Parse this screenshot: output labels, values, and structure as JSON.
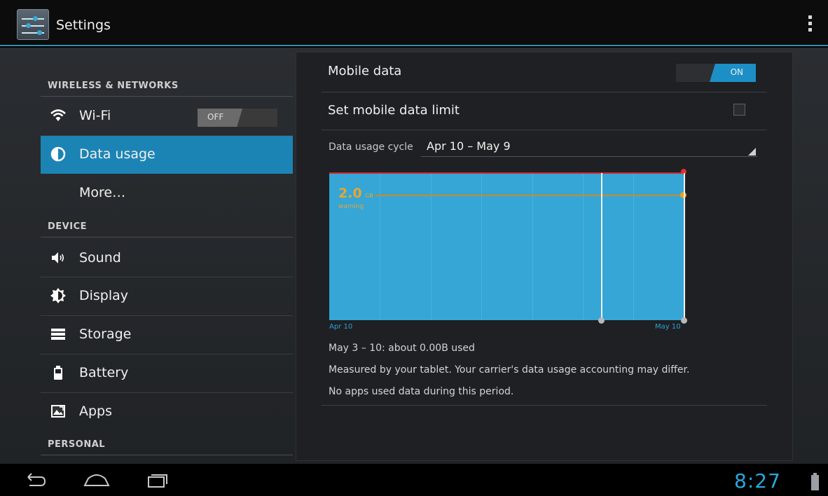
{
  "app": {
    "title": "Settings"
  },
  "sidebar": {
    "sections": {
      "wireless": "WIRELESS & NETWORKS",
      "device": "DEVICE",
      "personal": "PERSONAL"
    },
    "items": [
      {
        "label": "Wi-Fi",
        "icon": "wifi-icon",
        "toggle": "OFF"
      },
      {
        "label": "Data usage",
        "icon": "data-usage-icon",
        "selected": true
      },
      {
        "label": "More…",
        "icon": ""
      },
      {
        "label": "Sound",
        "icon": "speaker-icon"
      },
      {
        "label": "Display",
        "icon": "display-brightness-icon"
      },
      {
        "label": "Storage",
        "icon": "storage-icon"
      },
      {
        "label": "Battery",
        "icon": "battery-icon"
      },
      {
        "label": "Apps",
        "icon": "apps-icon"
      }
    ]
  },
  "main": {
    "mobile_data": {
      "label": "Mobile data",
      "toggle": "ON"
    },
    "data_limit": {
      "label": "Set mobile data limit",
      "checked": false
    },
    "cycle": {
      "label": "Data usage cycle",
      "value": "Apr 10 – May 9"
    },
    "chart": {
      "warning_value": "2.0",
      "warning_unit": "GB",
      "warning_caption": "warning",
      "start_label": "Apr 10",
      "end_label": "May 10"
    },
    "usage_summary": "May 3 – 10: about 0.00B used",
    "measured_note": "Measured by your tablet. Your carrier's data usage accounting may differ.",
    "no_apps_note": "No apps used data during this period."
  },
  "navbar": {
    "clock": "8:27"
  },
  "colors": {
    "accent": "#33b5e5",
    "selected": "#1c84b4",
    "chart_fill": "#35a6d6",
    "limit": "#d0262c",
    "warning": "#d08a1e"
  }
}
